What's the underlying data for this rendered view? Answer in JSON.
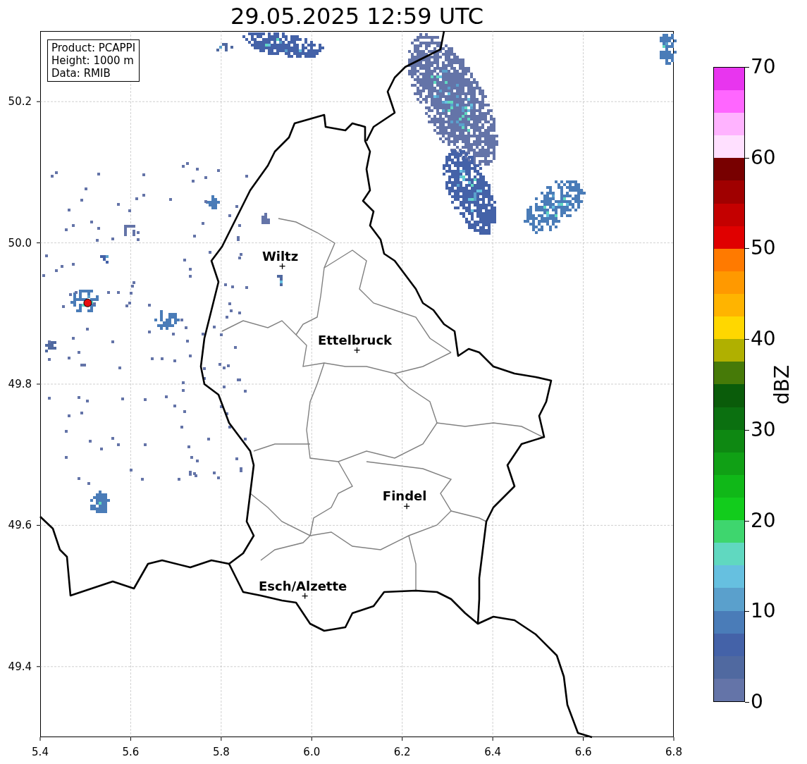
{
  "title": "29.05.2025 12:59 UTC",
  "info_box": [
    "Product: PCAPPI",
    "Height: 1000 m",
    "Data: RMIB"
  ],
  "x_ticks": [
    "5.4",
    "5.6",
    "5.8",
    "6.0",
    "6.2",
    "6.4",
    "6.6",
    "6.8"
  ],
  "y_ticks": [
    "50.2",
    "50.0",
    "49.8",
    "49.6",
    "49.4"
  ],
  "cities": [
    {
      "name": "Wiltz"
    },
    {
      "name": "Ettelbruck"
    },
    {
      "name": "Findel"
    },
    {
      "name": "Esch/Alzette"
    }
  ],
  "colorbar": {
    "label": "dBZ",
    "ticks": [
      "70",
      "60",
      "50",
      "40",
      "30",
      "20",
      "10",
      "0"
    ],
    "bins": [
      {
        "color": "#6474a8"
      },
      {
        "color": "#5069a0"
      },
      {
        "color": "#4462a8"
      },
      {
        "color": "#4a7cb8"
      },
      {
        "color": "#5aa0cc"
      },
      {
        "color": "#66c0e0"
      },
      {
        "color": "#60d8c0"
      },
      {
        "color": "#3ed66e"
      },
      {
        "color": "#12cc1c"
      },
      {
        "color": "#10b818"
      },
      {
        "color": "#10a015"
      },
      {
        "color": "#0e8812"
      },
      {
        "color": "#0b7010"
      },
      {
        "color": "#0a5c0a"
      },
      {
        "color": "#467a08"
      },
      {
        "color": "#b0b000"
      },
      {
        "color": "#ffd700"
      },
      {
        "color": "#ffb400"
      },
      {
        "color": "#ff9900"
      },
      {
        "color": "#ff7a00"
      },
      {
        "color": "#e00000"
      },
      {
        "color": "#c40000"
      },
      {
        "color": "#a00000"
      },
      {
        "color": "#780000"
      },
      {
        "color": "#ffe0ff"
      },
      {
        "color": "#ffb3ff"
      },
      {
        "color": "#ff66ff"
      },
      {
        "color": "#e835ef"
      }
    ]
  }
}
